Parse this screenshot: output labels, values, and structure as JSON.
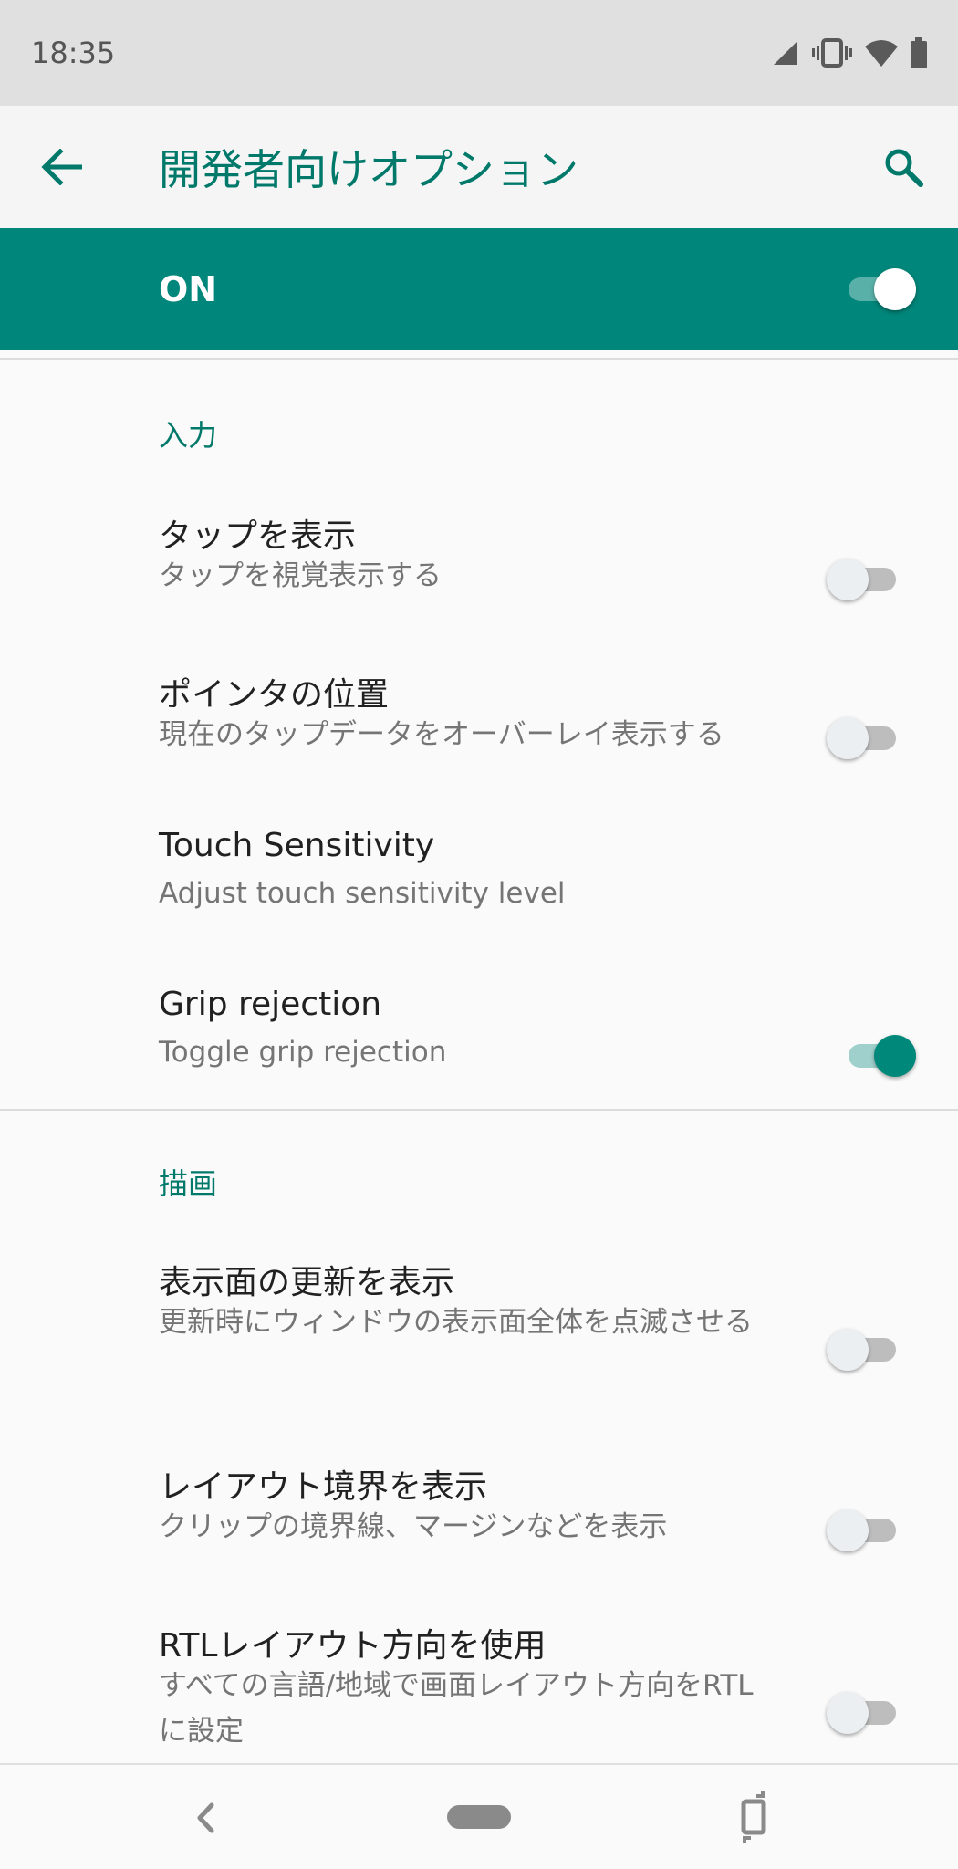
{
  "status_bar": {
    "time": "18:35"
  },
  "app_bar": {
    "title": "開発者向けオプション"
  },
  "master_switch": {
    "label": "ON",
    "state": "on"
  },
  "sections": [
    {
      "header": "入力",
      "items": [
        {
          "title": "タップを表示",
          "summary": "タップを視覚表示する",
          "toggle": "off"
        },
        {
          "title": "ポインタの位置",
          "summary": "現在のタップデータをオーバーレイ表示する",
          "toggle": "off"
        },
        {
          "title": "Touch Sensitivity",
          "summary": "Adjust touch sensitivity level",
          "toggle": null
        },
        {
          "title": "Grip rejection",
          "summary": "Toggle grip rejection",
          "toggle": "on"
        }
      ]
    },
    {
      "header": "描画",
      "items": [
        {
          "title": "表示面の更新を表示",
          "summary": "更新時にウィンドウの表示面全体を点滅させる",
          "toggle": "off"
        },
        {
          "title": "レイアウト境界を表示",
          "summary": "クリップの境界線、マージンなどを表示",
          "toggle": "off"
        },
        {
          "title": "RTLレイアウト方向を使用",
          "summary": "すべての言語/地域で画面レイアウト方向をRTLに設定",
          "toggle": "off"
        }
      ]
    }
  ],
  "colors": {
    "accent": "#00796b",
    "master_bar": "#00867a",
    "status_bar": "#e0e0e0"
  }
}
